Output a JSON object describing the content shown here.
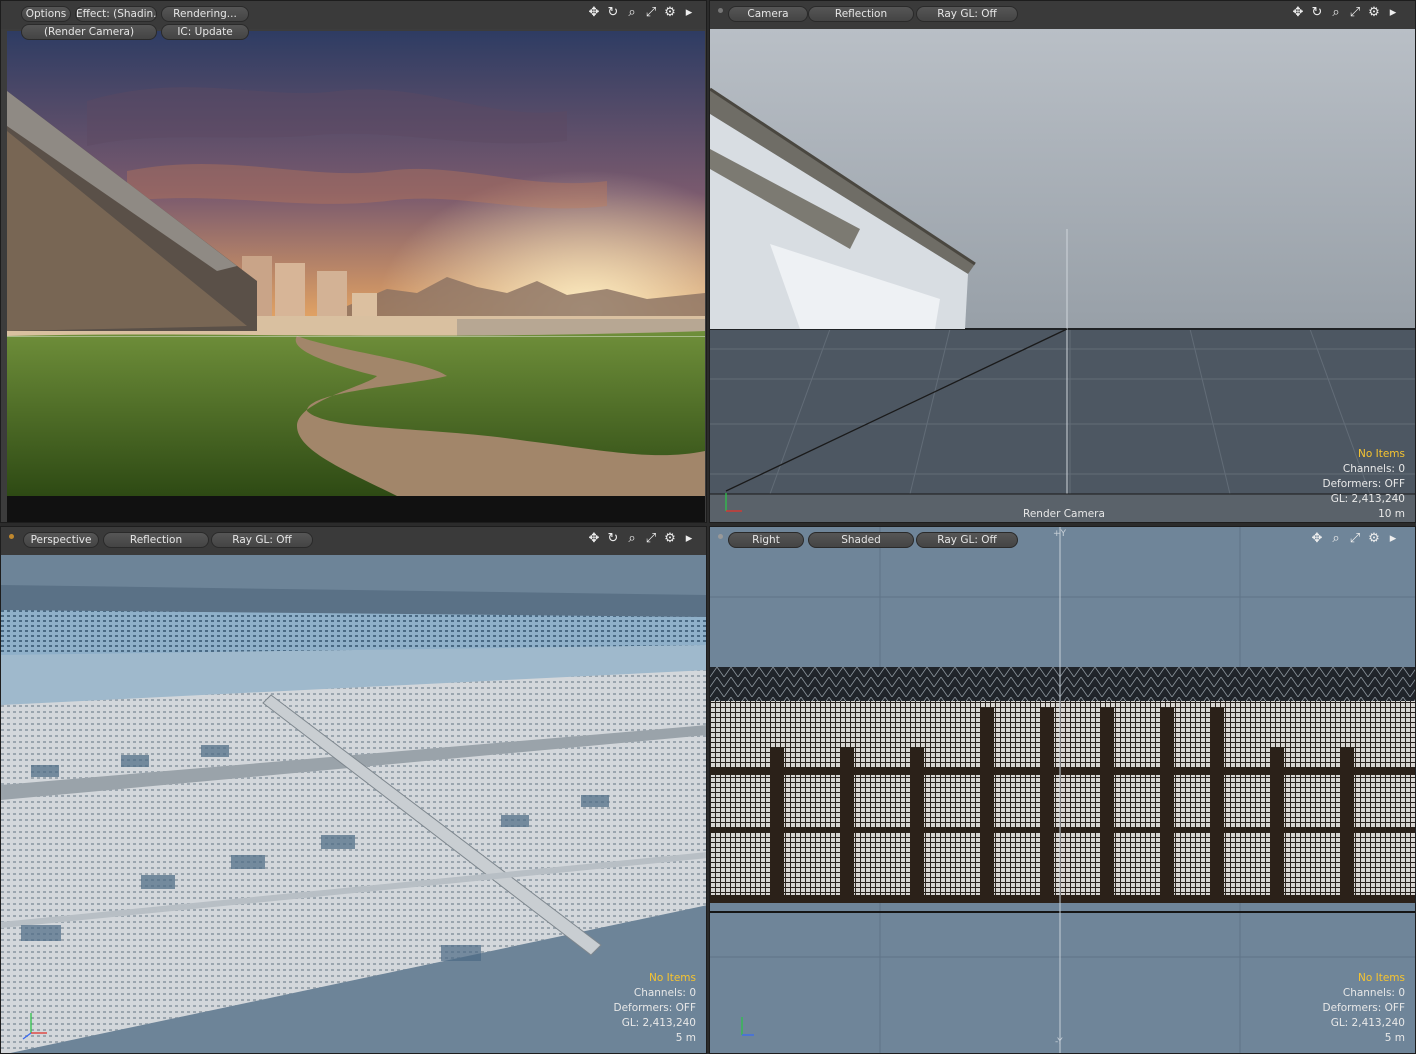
{
  "viewports": {
    "render": {
      "options": "Options",
      "effect": "Effect: (Shadin...",
      "rendering": "Rendering...",
      "camera": "(Render Camera)",
      "ic": "IC: Update"
    },
    "camera": {
      "view": "Camera",
      "mode": "Reflection",
      "raygl": "Ray GL: Off",
      "label": "Render Camera",
      "no_items": "No Items",
      "channels": "Channels: 0",
      "deformers": "Deformers: OFF",
      "gl": "GL: 2,413,240",
      "scale": "10 m"
    },
    "perspective": {
      "view": "Perspective",
      "mode": "Reflection",
      "raygl": "Ray GL: Off",
      "no_items": "No Items",
      "channels": "Channels: 0",
      "deformers": "Deformers: OFF",
      "gl": "GL: 2,413,240",
      "scale": "5 m"
    },
    "right": {
      "view": "Right",
      "mode": "Shaded",
      "raygl": "Ray GL: Off",
      "axis_top": "+Y",
      "axis_bottom": "-Y",
      "no_items": "No Items",
      "channels": "Channels: 0",
      "deformers": "Deformers: OFF",
      "gl": "GL: 2,413,240",
      "scale": "5 m"
    }
  },
  "icons": [
    "move-icon",
    "rotate-icon",
    "zoom-icon",
    "maximize-icon",
    "gear-icon",
    "expand-arrow-icon"
  ],
  "colors": {
    "accent": "#f6c430",
    "dot": "#c0882e",
    "bg": "#3c3c3c"
  }
}
